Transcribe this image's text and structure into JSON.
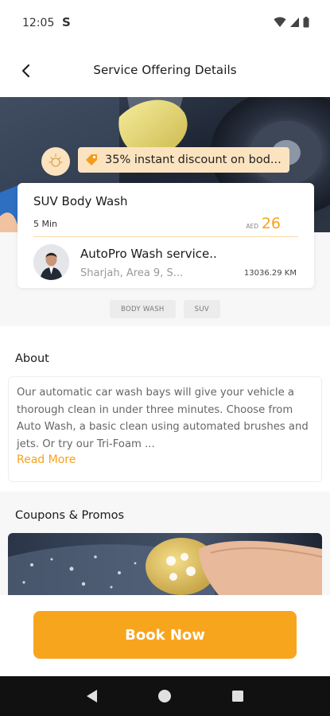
{
  "status_bar": {
    "time": "12:05",
    "extra_icon": "S"
  },
  "header": {
    "title": "Service Offering Details"
  },
  "hero": {
    "discount_text": "35% instant discount on bod..."
  },
  "service": {
    "title": "SUV Body Wash",
    "duration": "5 Min",
    "currency": "AED",
    "price": "26"
  },
  "provider": {
    "name": "AutoPro Wash service..",
    "location": "Sharjah, Area 9, S...",
    "distance": "13036.29 KM"
  },
  "tags": [
    "BODY WASH",
    "SUV"
  ],
  "about": {
    "heading": "About",
    "text": "Our automatic car wash bays will give your vehicle a thorough clean in under three minutes. Choose from Auto Wash, a basic clean using automated brushes and jets. Or try our Tri-Foam  ...",
    "read_more": "Read More"
  },
  "coupons": {
    "heading": "Coupons & Promos"
  },
  "actions": {
    "book_now": "Book Now"
  },
  "colors": {
    "accent": "#f8a51e",
    "pill_bg": "#fbe3c0",
    "nav_bg": "#111111"
  },
  "icons": [
    "wifi-icon",
    "signal-icon",
    "battery-icon",
    "back-arrow-icon",
    "sun-icon",
    "discount-tag-icon",
    "nav-back-icon",
    "nav-home-icon",
    "nav-recents-icon"
  ]
}
